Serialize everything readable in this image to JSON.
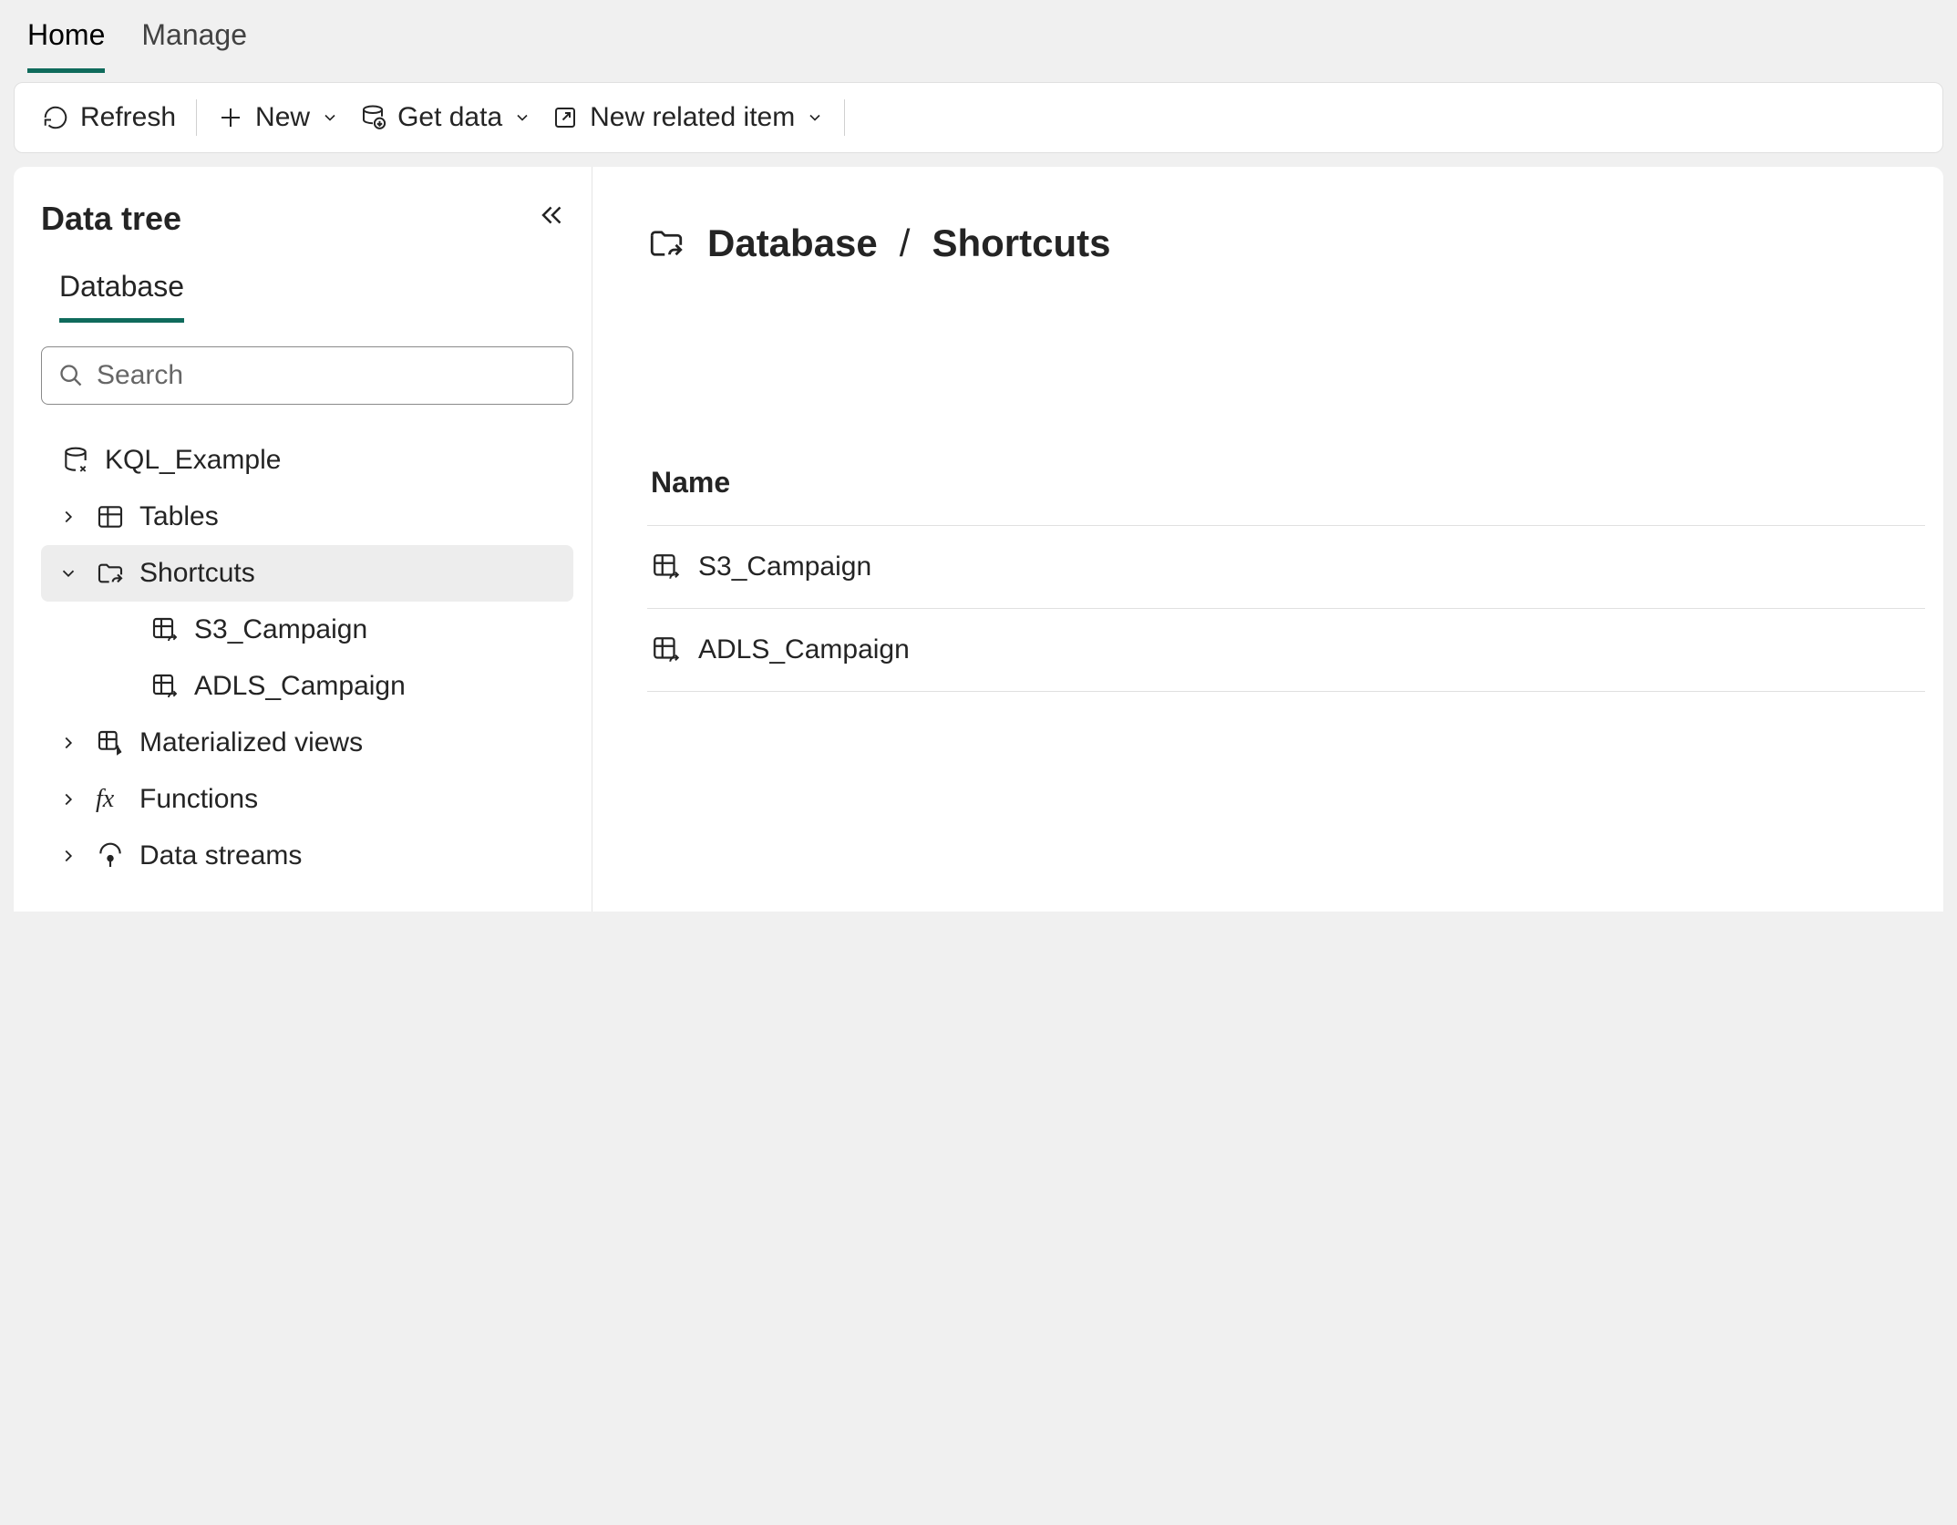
{
  "tabs": {
    "home": "Home",
    "manage": "Manage"
  },
  "toolbar": {
    "refresh": "Refresh",
    "new": "New",
    "get_data": "Get data",
    "new_related": "New related item"
  },
  "sidebar": {
    "title": "Data tree",
    "tab": "Database",
    "search_placeholder": "Search",
    "database_name": "KQL_Example",
    "nodes": {
      "tables": "Tables",
      "shortcuts": "Shortcuts",
      "mat_views": "Materialized views",
      "functions": "Functions",
      "data_streams": "Data streams"
    },
    "shortcut_items": [
      "S3_Campaign",
      "ADLS_Campaign"
    ]
  },
  "breadcrumb": {
    "database": "Database",
    "shortcuts": "Shortcuts"
  },
  "table": {
    "name_header": "Name",
    "rows": [
      "S3_Campaign",
      "ADLS_Campaign"
    ]
  }
}
